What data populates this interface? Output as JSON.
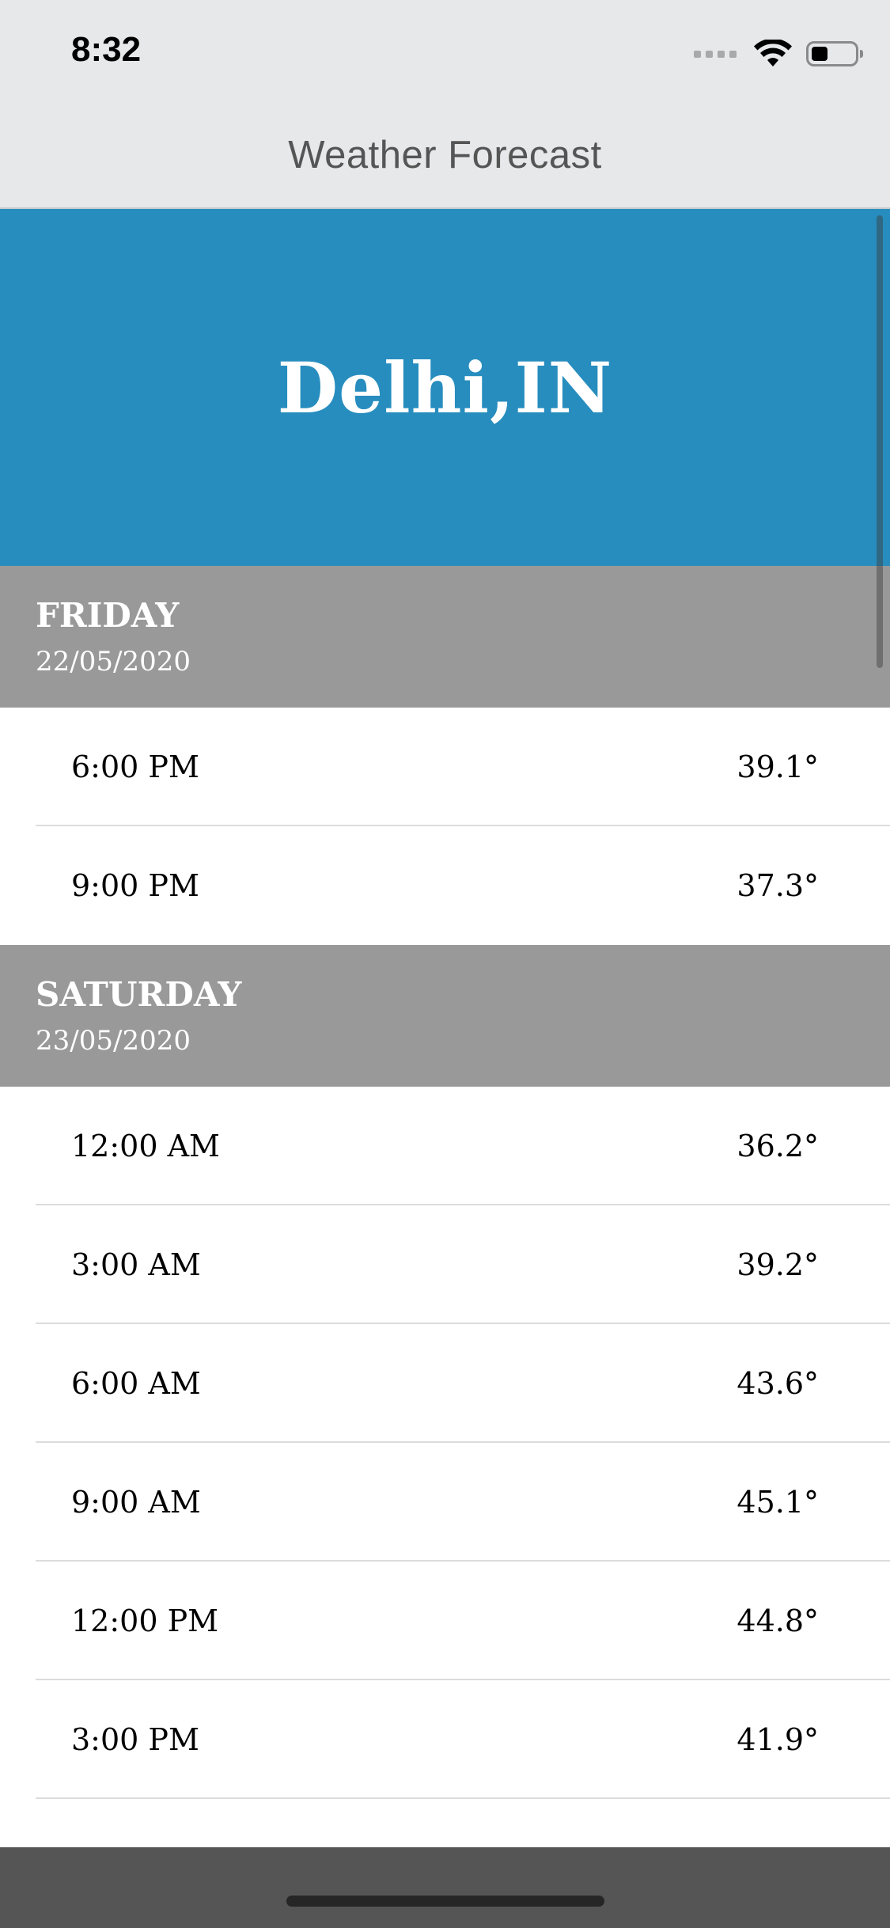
{
  "status_bar": {
    "time": "8:32",
    "icons": [
      "cellular-signal-icon",
      "wifi-icon",
      "battery-icon"
    ]
  },
  "nav": {
    "title": "Weather Forecast"
  },
  "city": {
    "name": "Delhi,IN"
  },
  "colors": {
    "header_blue": "#278dbe",
    "day_header_gray": "#999999",
    "bottom_bar": "#555555"
  },
  "days": [
    {
      "name": "FRIDAY",
      "date": "22/05/2020",
      "hours": [
        {
          "time": "6:00 PM",
          "temp": "39.1°"
        },
        {
          "time": "9:00 PM",
          "temp": "37.3°"
        }
      ]
    },
    {
      "name": "SATURDAY",
      "date": "23/05/2020",
      "hours": [
        {
          "time": "12:00 AM",
          "temp": "36.2°"
        },
        {
          "time": "3:00 AM",
          "temp": "39.2°"
        },
        {
          "time": "6:00 AM",
          "temp": "43.6°"
        },
        {
          "time": "9:00 AM",
          "temp": "45.1°"
        },
        {
          "time": "12:00 PM",
          "temp": "44.8°"
        },
        {
          "time": "3:00 PM",
          "temp": "41.9°"
        }
      ]
    }
  ]
}
